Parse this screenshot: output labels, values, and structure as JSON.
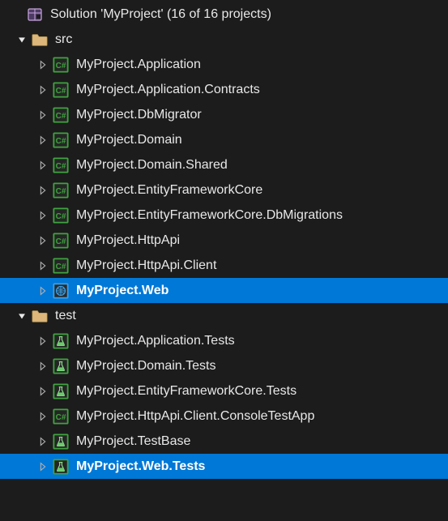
{
  "colors": {
    "bg": "#1c1c1c",
    "text": "#e8e8e8",
    "selection": "#0078d7",
    "folder": "#dcb67a",
    "csharp_border": "#3fa33f",
    "csharp_bg": "#252525",
    "csharp_text": "#3fa33f",
    "web_border": "#3aa0e8",
    "web_bg": "#2a2a2a",
    "web_icon": "#3aa0e8",
    "test_border": "#3fa33f",
    "test_bg": "#252525",
    "test_fill": "#6dc96d",
    "solution_outline": "#c9a6e0",
    "solution_fill": "#4d3a63"
  },
  "solution": {
    "label": "Solution 'MyProject' (16 of 16 projects)",
    "folders": [
      {
        "name": "src",
        "expanded": true,
        "projects": [
          {
            "name": "MyProject.Application",
            "icon": "csharp",
            "selected": false
          },
          {
            "name": "MyProject.Application.Contracts",
            "icon": "csharp",
            "selected": false
          },
          {
            "name": "MyProject.DbMigrator",
            "icon": "csharp",
            "selected": false
          },
          {
            "name": "MyProject.Domain",
            "icon": "csharp",
            "selected": false
          },
          {
            "name": "MyProject.Domain.Shared",
            "icon": "csharp",
            "selected": false
          },
          {
            "name": "MyProject.EntityFrameworkCore",
            "icon": "csharp",
            "selected": false
          },
          {
            "name": "MyProject.EntityFrameworkCore.DbMigrations",
            "icon": "csharp",
            "selected": false
          },
          {
            "name": "MyProject.HttpApi",
            "icon": "csharp",
            "selected": false
          },
          {
            "name": "MyProject.HttpApi.Client",
            "icon": "csharp",
            "selected": false
          },
          {
            "name": "MyProject.Web",
            "icon": "web",
            "selected": true
          }
        ]
      },
      {
        "name": "test",
        "expanded": true,
        "projects": [
          {
            "name": "MyProject.Application.Tests",
            "icon": "test",
            "selected": false
          },
          {
            "name": "MyProject.Domain.Tests",
            "icon": "test",
            "selected": false
          },
          {
            "name": "MyProject.EntityFrameworkCore.Tests",
            "icon": "test",
            "selected": false
          },
          {
            "name": "MyProject.HttpApi.Client.ConsoleTestApp",
            "icon": "csharp",
            "selected": false
          },
          {
            "name": "MyProject.TestBase",
            "icon": "test",
            "selected": false
          },
          {
            "name": "MyProject.Web.Tests",
            "icon": "test",
            "selected": true
          }
        ]
      }
    ]
  },
  "indents": {
    "solution": 0,
    "folder": 18,
    "project": 44
  }
}
